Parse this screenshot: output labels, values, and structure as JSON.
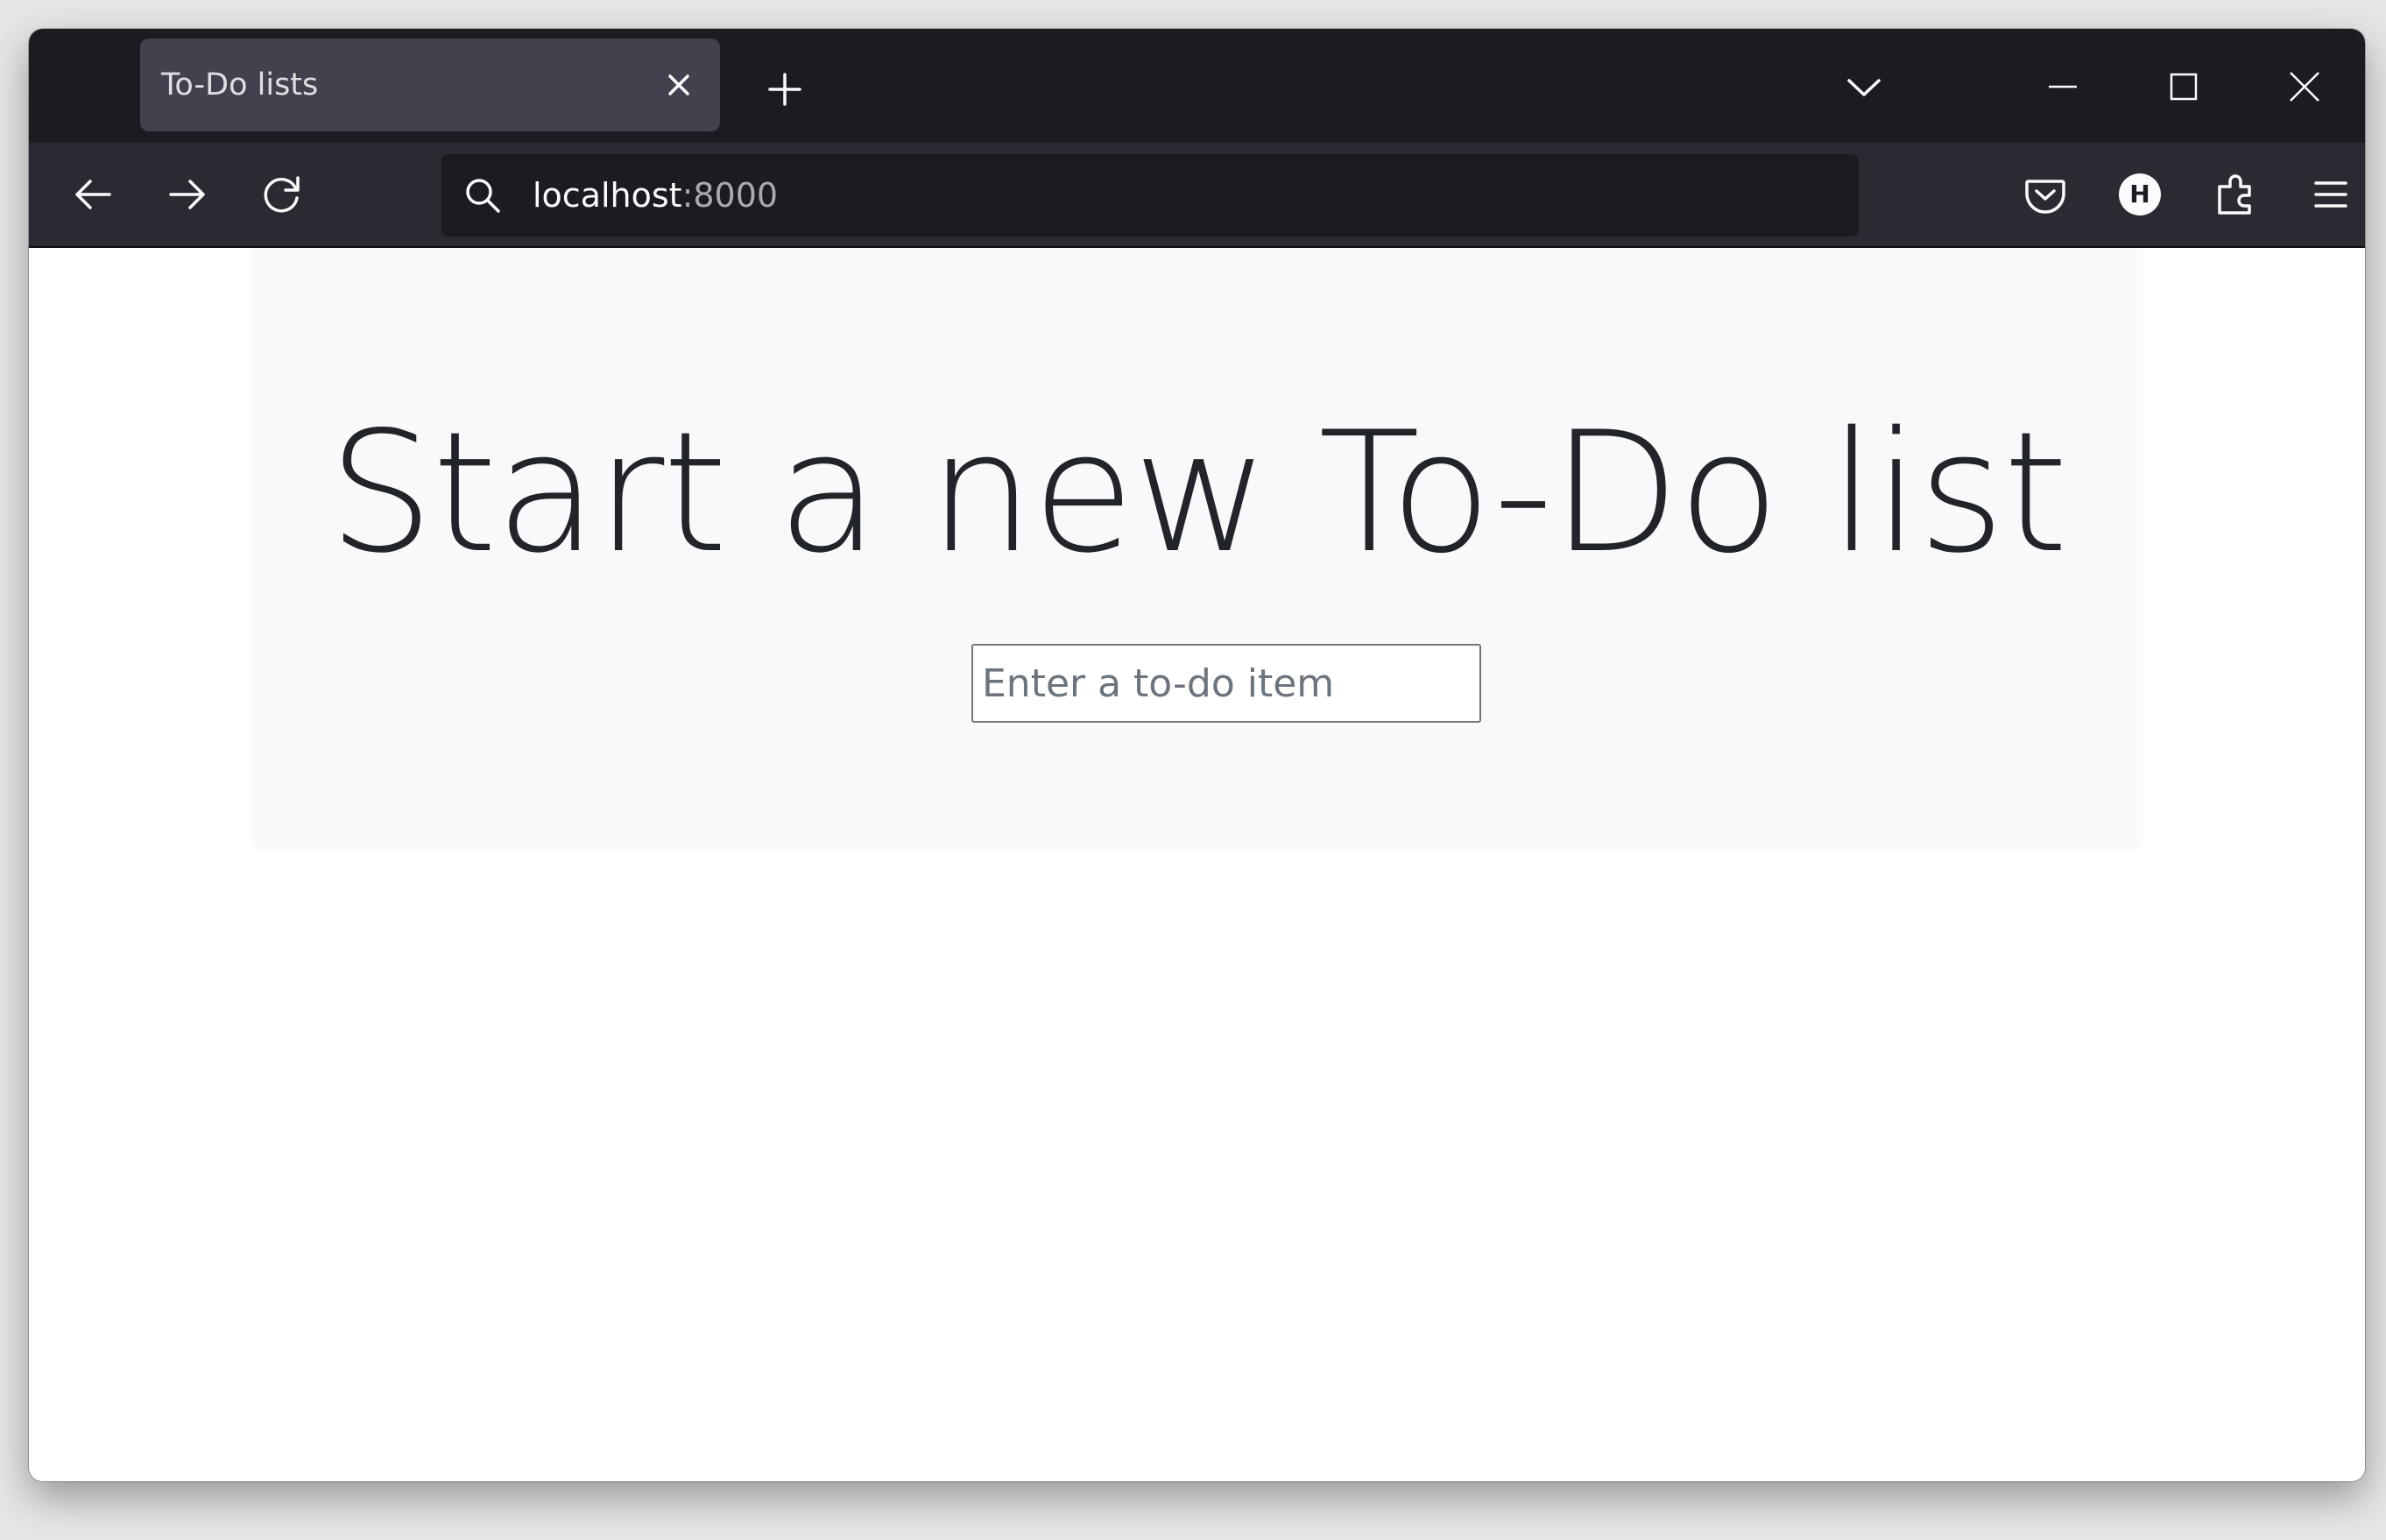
{
  "browser": {
    "tab": {
      "title": "To-Do lists",
      "close_icon": "close-icon"
    },
    "new_tab_icon": "plus-icon",
    "tab_list_icon": "chevron-down-icon",
    "window_controls": [
      "minimize-icon",
      "maximize-icon",
      "close-icon"
    ],
    "nav": {
      "back_icon": "arrow-left-icon",
      "forward_icon": "arrow-right-icon",
      "reload_icon": "reload-icon"
    },
    "address_bar": {
      "host": "localhost",
      "port": ":8000",
      "search_icon": "search-icon"
    },
    "toolbar_icons": [
      "pocket-icon",
      "profile-avatar-icon",
      "extensions-icon",
      "menu-icon"
    ],
    "avatar_letter": "H"
  },
  "page": {
    "heading": "Start a new To-Do list",
    "new_item_input": {
      "value": "",
      "placeholder": "Enter a to-do item"
    }
  },
  "colors": {
    "titlebar": "#1c1b22",
    "toolbar": "#2b2a33",
    "active_tab": "#42414d",
    "jumbotron": "#f8f9fa",
    "heading_text": "#212529"
  }
}
